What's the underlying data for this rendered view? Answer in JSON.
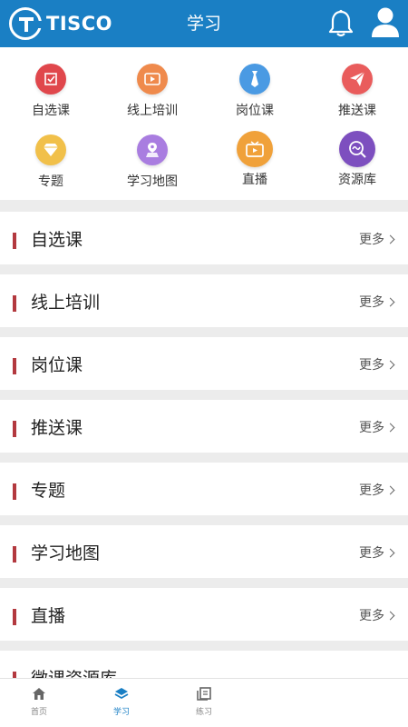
{
  "header": {
    "brand": "TISCO",
    "title": "学习",
    "color": "#1a7fc4"
  },
  "shortcuts": [
    {
      "label": "自选课",
      "icon": "checkbox-icon",
      "color": "#e0474c"
    },
    {
      "label": "线上培训",
      "icon": "video-play-icon",
      "color": "#ef8a4c"
    },
    {
      "label": "岗位课",
      "icon": "tie-icon",
      "color": "#4a9ae3"
    },
    {
      "label": "推送课",
      "icon": "paper-plane-icon",
      "color": "#e95c5c"
    },
    {
      "label": "专题",
      "icon": "diamond-icon",
      "color": "#f1c04a"
    },
    {
      "label": "学习地图",
      "icon": "map-pin-icon",
      "color": "#a97de0"
    },
    {
      "label": "直播",
      "icon": "live-tv-icon",
      "color": "#f0a13a"
    },
    {
      "label": "资源库",
      "icon": "resource-search-icon",
      "color": "#7d4fbf"
    }
  ],
  "sections": [
    {
      "title": "自选课",
      "more": "更多"
    },
    {
      "title": "线上培训",
      "more": "更多"
    },
    {
      "title": "岗位课",
      "more": "更多"
    },
    {
      "title": "推送课",
      "more": "更多"
    },
    {
      "title": "专题",
      "more": "更多"
    },
    {
      "title": "学习地图",
      "more": "更多"
    },
    {
      "title": "直播",
      "more": "更多"
    },
    {
      "title": "微课资源库",
      "more": ""
    }
  ],
  "tabbar": {
    "items": [
      {
        "label": "首页",
        "icon": "home-icon",
        "active": false
      },
      {
        "label": "学习",
        "icon": "layers-icon",
        "active": true
      },
      {
        "label": "练习",
        "icon": "notebook-icon",
        "active": false
      }
    ],
    "active_color": "#1a7fc4"
  }
}
